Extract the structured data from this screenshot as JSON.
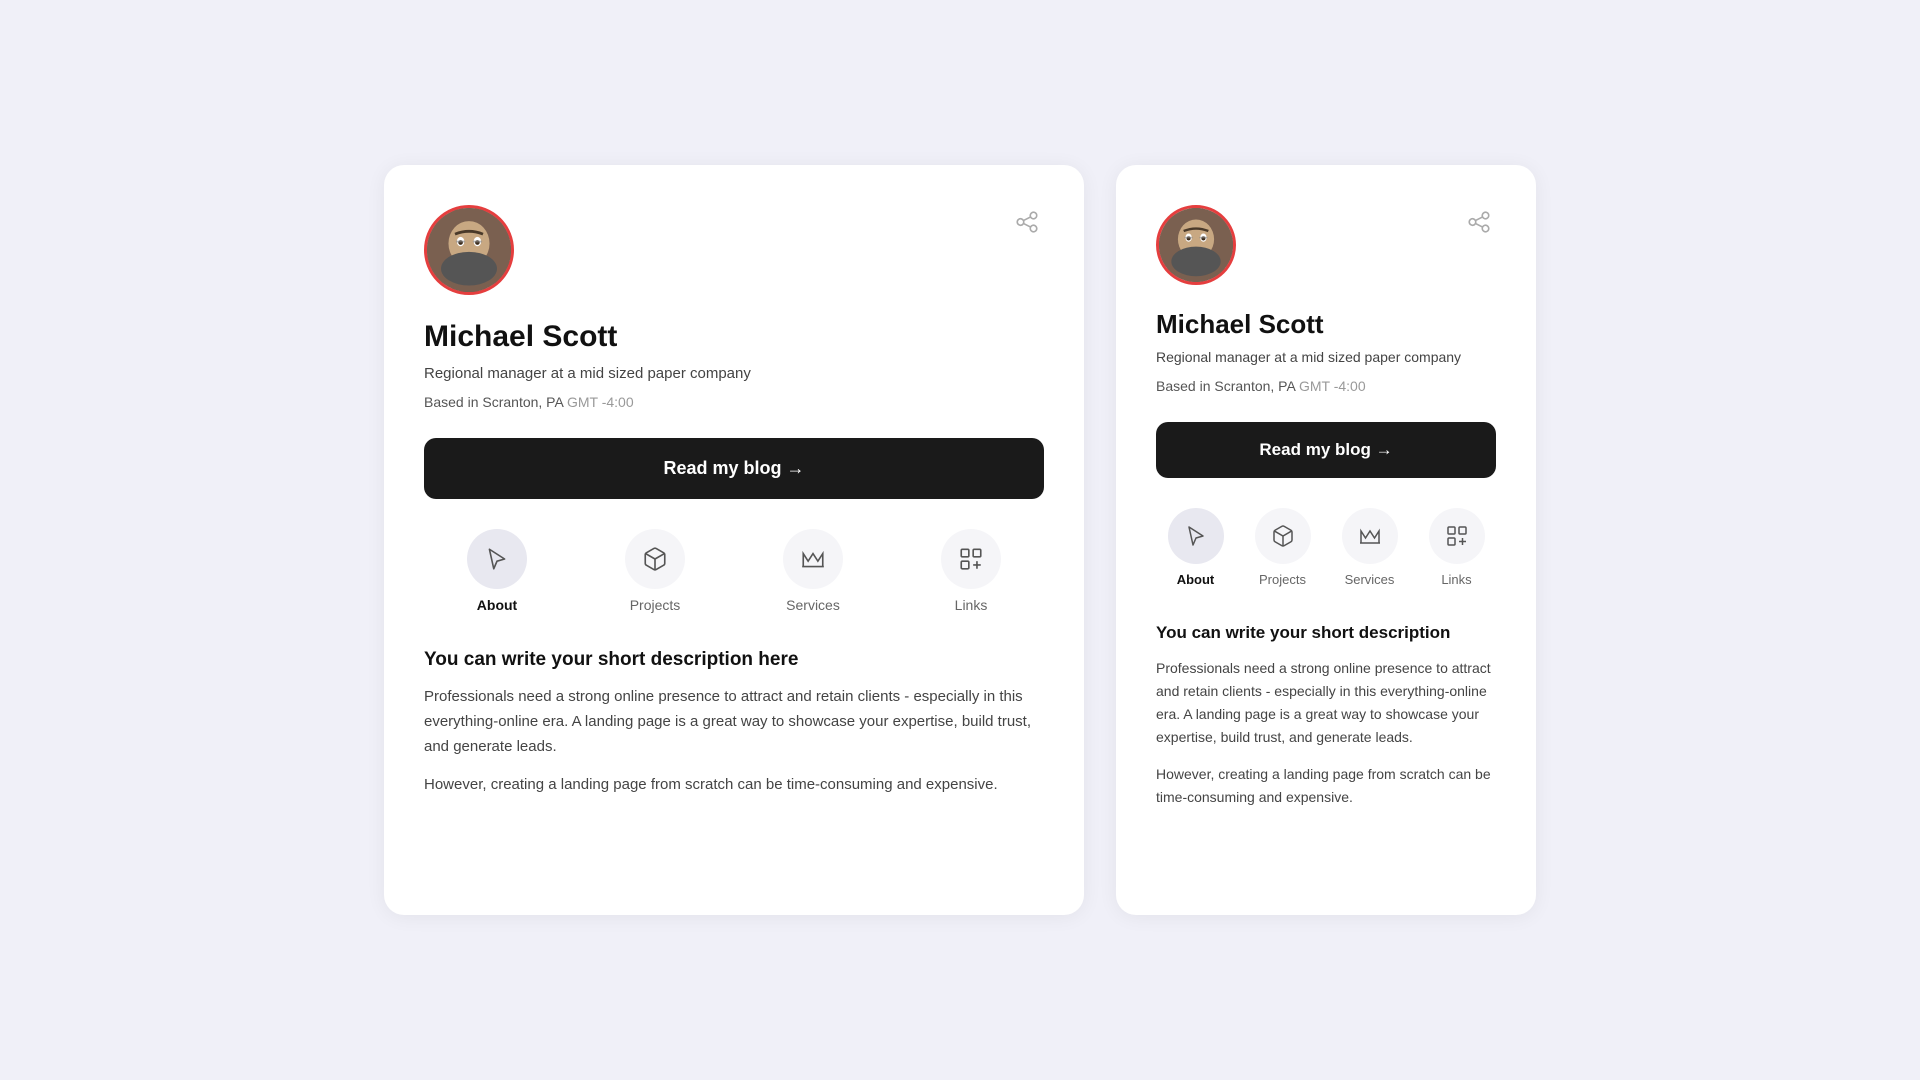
{
  "cards": [
    {
      "id": "card-left",
      "person": {
        "name": "Michael Scott",
        "title": "Regional manager at a mid sized paper company",
        "location": "Based in Scranton, PA",
        "timezone": "GMT -4:00"
      },
      "blog_button": "Read my blog →",
      "nav_tabs": [
        {
          "id": "about",
          "label": "About",
          "active": true
        },
        {
          "id": "projects",
          "label": "Projects",
          "active": false
        },
        {
          "id": "services",
          "label": "Services",
          "active": false
        },
        {
          "id": "links",
          "label": "Links",
          "active": false
        }
      ],
      "content": {
        "heading": "You can write your short description here",
        "paragraphs": [
          "Professionals need a strong online presence to attract and retain clients - especially in this everything-online era. A landing page is a great way to showcase your expertise, build trust, and generate leads.",
          "However, creating a landing page from scratch can be time-consuming and expensive."
        ]
      }
    },
    {
      "id": "card-right",
      "person": {
        "name": "Michael Scott",
        "title": "Regional manager at a mid sized paper company",
        "location": "Based in Scranton, PA",
        "timezone": "GMT -4:00"
      },
      "blog_button": "Read my blog →",
      "nav_tabs": [
        {
          "id": "about",
          "label": "About",
          "active": true
        },
        {
          "id": "projects",
          "label": "Projects",
          "active": false
        },
        {
          "id": "services",
          "label": "Services",
          "active": false
        },
        {
          "id": "links",
          "label": "Links",
          "active": false
        }
      ],
      "content": {
        "heading": "You can write your short description",
        "paragraphs": [
          "Professionals need a strong online presence to attract and retain clients - especially in this everything-online era. A landing page is a great way to showcase your expertise, build trust, and generate leads.",
          "However, creating a landing page from scratch can be time-consuming and expensive."
        ]
      }
    }
  ],
  "icons": {
    "about": "cursor",
    "projects": "box",
    "services": "crown",
    "links": "grid"
  }
}
